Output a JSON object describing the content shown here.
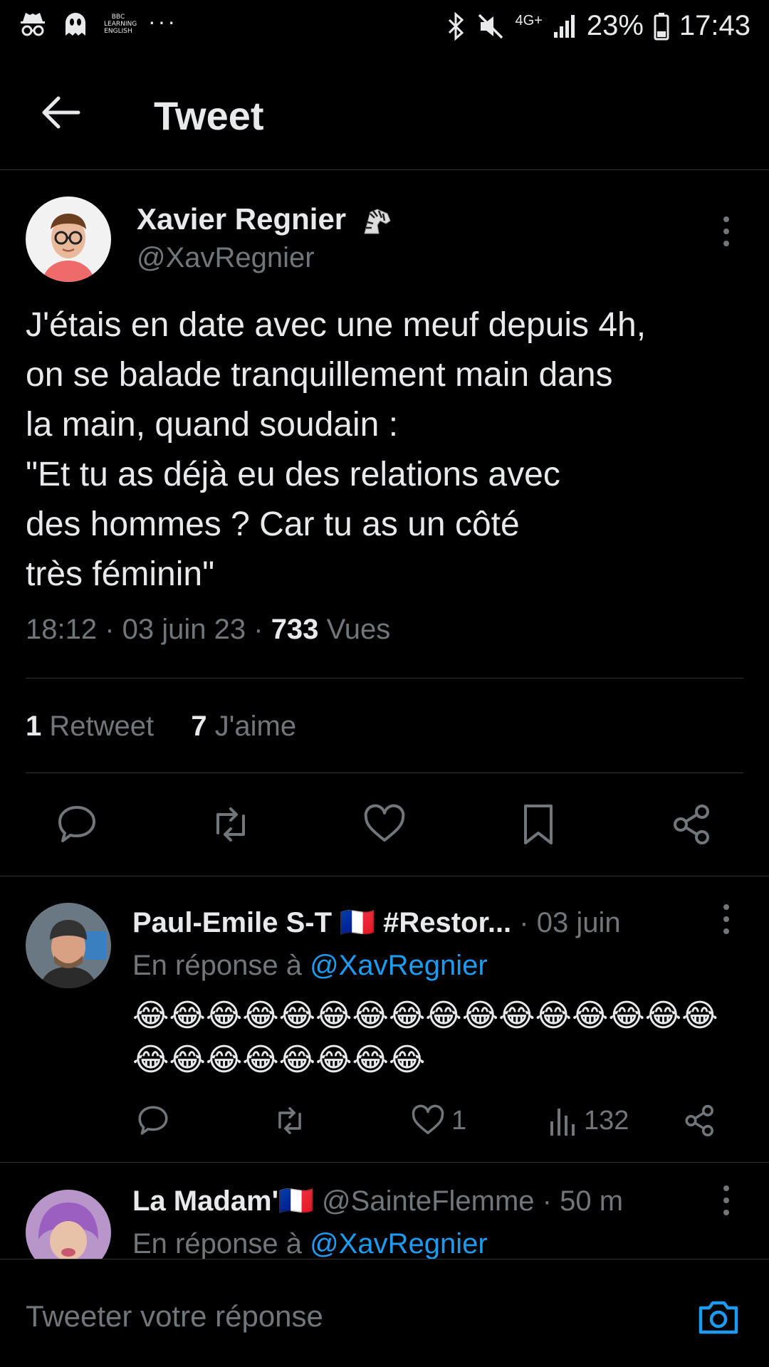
{
  "status_bar": {
    "bbc_label": "BBC LEARNING ENGLISH",
    "more": "···",
    "network": "4G+",
    "battery": "23%",
    "time": "17:43"
  },
  "header": {
    "title": "Tweet"
  },
  "tweet": {
    "author_name": "Xavier Regnier",
    "author_badge_icon": "zebra-emoji",
    "handle": "@XavRegnier",
    "text": "J'étais en date avec une meuf depuis 4h,\non se balade tranquillement main dans\nla main, quand soudain :\n\"Et tu as déjà eu des relations avec\ndes hommes ? Car tu as un côté\ntrès féminin\"",
    "time": "18:12",
    "date": "03 juin 23",
    "views_count": "733",
    "views_label": "Vues",
    "retweet_count": "1",
    "retweet_label": "Retweet",
    "like_count": "7",
    "like_label": "J'aime"
  },
  "replies": [
    {
      "name": "Paul-Emile S-T 🇫🇷 #Restor...",
      "time": "03 juin",
      "reply_prefix": "En réponse à",
      "reply_to": "@XavRegnier",
      "text_line1": "😂😂😂😂😂😂😂😂😂😂😂😂😂😂😂😂",
      "text_line2": "😂😂😂😂😂😂😂😂",
      "like_count": "1",
      "views_count": "132"
    },
    {
      "name": "La Madam'🇫🇷",
      "handle": "@SainteFlemme",
      "time": "50 m",
      "reply_prefix": "En réponse à",
      "reply_to": "@XavRegnier"
    }
  ],
  "compose": {
    "placeholder": "Tweeter votre réponse"
  },
  "colors": {
    "background": "#000000",
    "text": "#e7e9ea",
    "secondary": "#71767b",
    "accent": "#1d9bf0",
    "divider": "#2f3336"
  }
}
